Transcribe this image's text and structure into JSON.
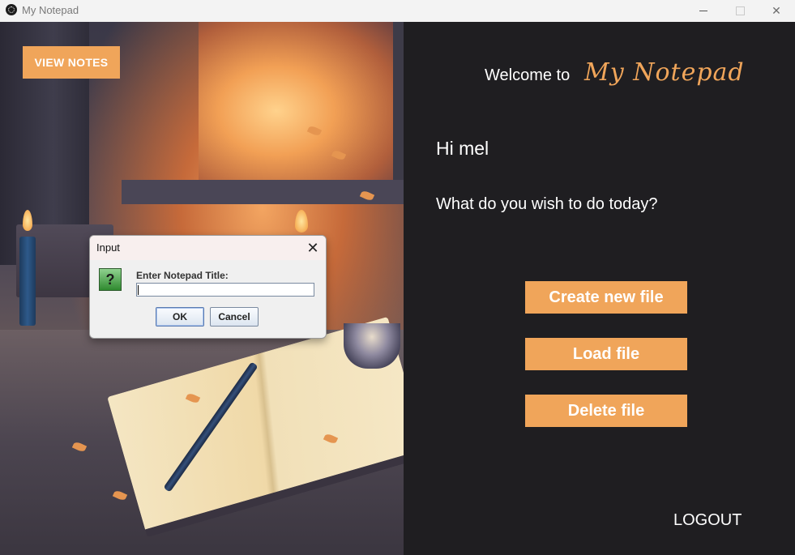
{
  "window": {
    "title": "My Notepad"
  },
  "left": {
    "view_notes_label": "VIEW NOTES"
  },
  "right": {
    "welcome_text": "Welcome to",
    "brand_text": "My Notepad",
    "greeting": "Hi mel",
    "question": "What do you wish to do today?",
    "buttons": {
      "create": "Create new file",
      "load": "Load file",
      "delete": "Delete file"
    },
    "logout_label": "LOGOUT"
  },
  "dialog": {
    "title": "Input",
    "close_glyph": "✕",
    "icon_glyph": "?",
    "prompt": "Enter Notepad Title:",
    "input_value": "",
    "ok_label": "OK",
    "cancel_label": "Cancel"
  },
  "colors": {
    "accent": "#f0a55a",
    "background": "#1f1e21"
  },
  "icons": [
    "app-icon",
    "minimize-icon",
    "maximize-icon",
    "close-icon",
    "question-icon",
    "dialog-close-icon"
  ]
}
